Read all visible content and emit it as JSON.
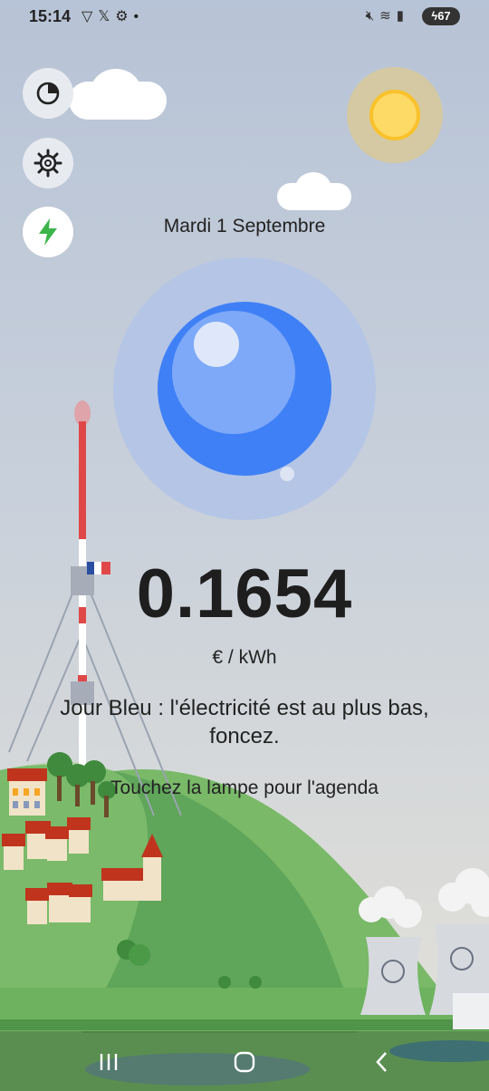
{
  "status_bar": {
    "time": "15:14",
    "left_icons": [
      "shield-icon",
      "x-icon",
      "gear-icon",
      "dot-icon"
    ],
    "right_icons": [
      "mute-icon",
      "wifi-icon",
      "signal-icon"
    ],
    "battery": "67"
  },
  "side_buttons": [
    {
      "name": "history-button",
      "icon": "pie-chart-icon"
    },
    {
      "name": "settings-button",
      "icon": "gear-icon"
    },
    {
      "name": "power-button",
      "icon": "lightning-icon"
    }
  ],
  "date": "Mardi 1 Septembre",
  "price": {
    "value": "0.1654",
    "unit": "€ / kWh"
  },
  "day_message": "Jour Bleu : l'électricité est au plus bas, foncez.",
  "hint": "Touchez la lampe pour l'agenda",
  "colors": {
    "day_blue": "#3f80f6",
    "halo": "#b5c5e6",
    "hill_green": "#5fa55a",
    "tower_red": "#e04848",
    "sun": "#fdd966"
  },
  "nav_bar": {
    "buttons": [
      "recents-icon",
      "home-icon",
      "back-icon"
    ]
  }
}
